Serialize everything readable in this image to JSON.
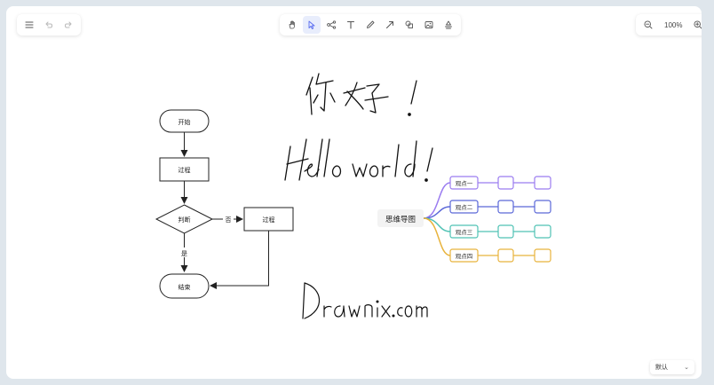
{
  "zoom": {
    "level": "100%"
  },
  "flowchart": {
    "start": "开始",
    "process1": "过程",
    "decision": "判断",
    "no": "否",
    "yes": "是",
    "process2": "过程",
    "end": "结束"
  },
  "mindmap": {
    "root": "思维导图",
    "nodes": [
      "观点一",
      "观点二",
      "观点三",
      "观点四"
    ],
    "colors": [
      "#9b7cf0",
      "#5a67d8",
      "#4fc2b4",
      "#e8b33c"
    ]
  },
  "theme": {
    "selected": "默认"
  },
  "icons": {
    "menu": "menu-icon",
    "undo": "undo-icon",
    "redo": "redo-icon",
    "hand": "hand-icon",
    "select": "pointer-icon",
    "mind": "mindmap-icon",
    "text": "text-icon",
    "pen": "pen-icon",
    "arrow": "arrow-icon",
    "shape": "shape-icon",
    "image": "image-icon",
    "extra": "extra-icon",
    "zoom_out": "zoom-out-icon",
    "zoom_in": "zoom-in-icon"
  }
}
